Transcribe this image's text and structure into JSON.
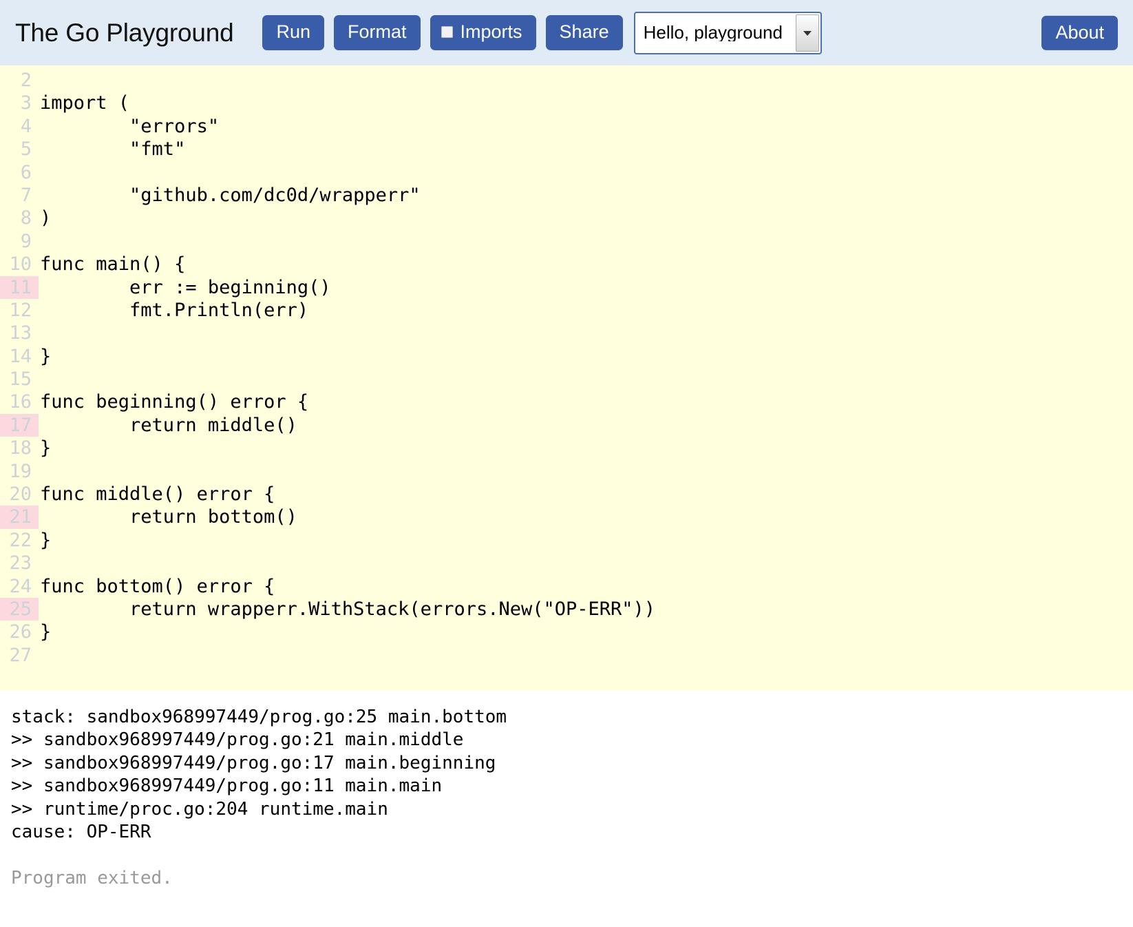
{
  "header": {
    "title": "The Go Playground",
    "buttons": [
      {
        "name": "run",
        "label": "Run"
      },
      {
        "name": "format",
        "label": "Format"
      },
      {
        "name": "imports",
        "label": "Imports"
      },
      {
        "name": "share",
        "label": "Share"
      }
    ],
    "run_label": "Run",
    "format_label": "Format",
    "imports_label": "Imports",
    "share_label": "Share",
    "about_label": "About",
    "example_select": {
      "value": "Hello, playground",
      "options": [
        "Hello, playground"
      ]
    },
    "colors": {
      "header_bg": "#e0ebf5",
      "button_bg": "#3a5da9",
      "button_text": "#ffffff"
    }
  },
  "editor": {
    "colors": {
      "background": "#ffffdd",
      "gutter_text": "#cdd2d8",
      "highlight": "#fbd9de",
      "code_text": "#000000"
    },
    "lines": [
      {
        "number": "2",
        "code": "",
        "highlighted": false
      },
      {
        "number": "3",
        "code": "import (",
        "highlighted": false
      },
      {
        "number": "4",
        "code": "        \"errors\"",
        "highlighted": false
      },
      {
        "number": "5",
        "code": "        \"fmt\"",
        "highlighted": false
      },
      {
        "number": "6",
        "code": "",
        "highlighted": false
      },
      {
        "number": "7",
        "code": "        \"github.com/dc0d/wrapperr\"",
        "highlighted": false
      },
      {
        "number": "8",
        "code": ")",
        "highlighted": false
      },
      {
        "number": "9",
        "code": "",
        "highlighted": false
      },
      {
        "number": "10",
        "code": "func main() {",
        "highlighted": false
      },
      {
        "number": "11",
        "code": "        err := beginning()",
        "highlighted": true
      },
      {
        "number": "12",
        "code": "        fmt.Println(err)",
        "highlighted": false
      },
      {
        "number": "13",
        "code": "",
        "highlighted": false
      },
      {
        "number": "14",
        "code": "}",
        "highlighted": false
      },
      {
        "number": "15",
        "code": "",
        "highlighted": false
      },
      {
        "number": "16",
        "code": "func beginning() error {",
        "highlighted": false
      },
      {
        "number": "17",
        "code": "        return middle()",
        "highlighted": true
      },
      {
        "number": "18",
        "code": "}",
        "highlighted": false
      },
      {
        "number": "19",
        "code": "",
        "highlighted": false
      },
      {
        "number": "20",
        "code": "func middle() error {",
        "highlighted": false
      },
      {
        "number": "21",
        "code": "        return bottom()",
        "highlighted": true
      },
      {
        "number": "22",
        "code": "}",
        "highlighted": false
      },
      {
        "number": "23",
        "code": "",
        "highlighted": false
      },
      {
        "number": "24",
        "code": "func bottom() error {",
        "highlighted": false
      },
      {
        "number": "25",
        "code": "        return wrapperr.WithStack(errors.New(\"OP-ERR\"))",
        "highlighted": true
      },
      {
        "number": "26",
        "code": "}",
        "highlighted": false
      },
      {
        "number": "27",
        "code": "",
        "highlighted": false
      }
    ]
  },
  "output": {
    "lines": [
      {
        "text": "stack: sandbox968997449/prog.go:25 main.bottom",
        "system": false
      },
      {
        "text": ">> sandbox968997449/prog.go:21 main.middle",
        "system": false
      },
      {
        "text": ">> sandbox968997449/prog.go:17 main.beginning",
        "system": false
      },
      {
        "text": ">> sandbox968997449/prog.go:11 main.main",
        "system": false
      },
      {
        "text": ">> runtime/proc.go:204 runtime.main",
        "system": false
      },
      {
        "text": "cause: OP-ERR",
        "system": false
      },
      {
        "text": "",
        "system": false
      },
      {
        "text": "Program exited.",
        "system": true
      }
    ]
  }
}
